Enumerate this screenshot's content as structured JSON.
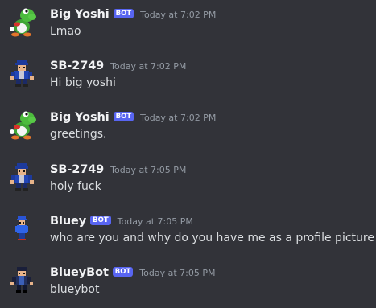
{
  "messages": [
    {
      "username": "Big Yoshi",
      "badge": "BOT",
      "timestamp": "Today at 7:02 PM",
      "text": "Lmao",
      "avatar": "yoshi-avatar-icon"
    },
    {
      "username": "SB-2749",
      "badge": "",
      "timestamp": "Today at 7:02 PM",
      "text": "Hi big yoshi",
      "avatar": "pixel-character-avatar-icon"
    },
    {
      "username": "Big Yoshi",
      "badge": "BOT",
      "timestamp": "Today at 7:02 PM",
      "text": "greetings.",
      "avatar": "yoshi-avatar-icon"
    },
    {
      "username": "SB-2749",
      "badge": "",
      "timestamp": "Today at 7:05 PM",
      "text": "holy fuck",
      "avatar": "pixel-character-avatar-icon"
    },
    {
      "username": "Bluey",
      "badge": "BOT",
      "timestamp": "Today at 7:05 PM",
      "text": "who are you and why do you have me as a profile picture",
      "avatar": "blue-pixel-character-avatar-icon"
    },
    {
      "username": "BlueyBot",
      "badge": "BOT",
      "timestamp": "Today at 7:05 PM",
      "text": "blueybot",
      "avatar": "dark-pixel-character-avatar-icon"
    }
  ],
  "colors": {
    "background": "#323339",
    "username": "#f2f3f5",
    "badge": "#5865f2",
    "timestamp": "#949ba4",
    "text": "#dbdee1"
  }
}
